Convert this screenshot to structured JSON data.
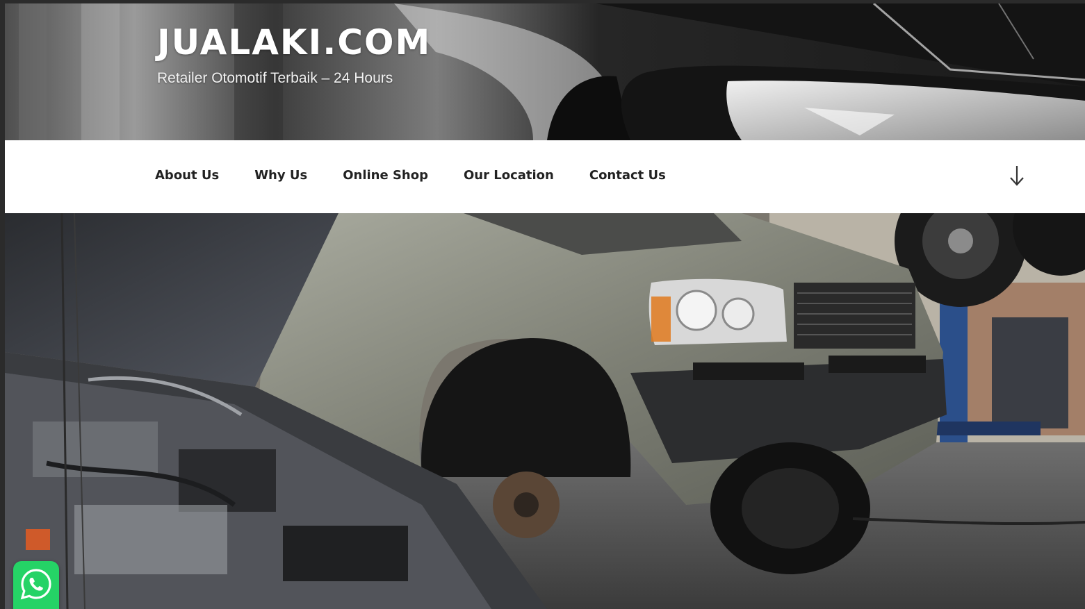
{
  "site": {
    "title": "JUALAKI.COM",
    "tagline": "Retailer Otomotif Terbaik – 24 Hours"
  },
  "nav": {
    "items": [
      {
        "label": "About Us"
      },
      {
        "label": "Why Us"
      },
      {
        "label": "Online Shop"
      },
      {
        "label": "Our Location"
      },
      {
        "label": "Contact Us"
      }
    ],
    "scroll_icon": "arrow-down-icon"
  },
  "widgets": {
    "chat_icon": "whatsapp-icon"
  },
  "colors": {
    "nav_background": "#ffffff",
    "nav_text": "#222222",
    "title_text": "#ffffff",
    "whatsapp_green": "#25d366"
  }
}
